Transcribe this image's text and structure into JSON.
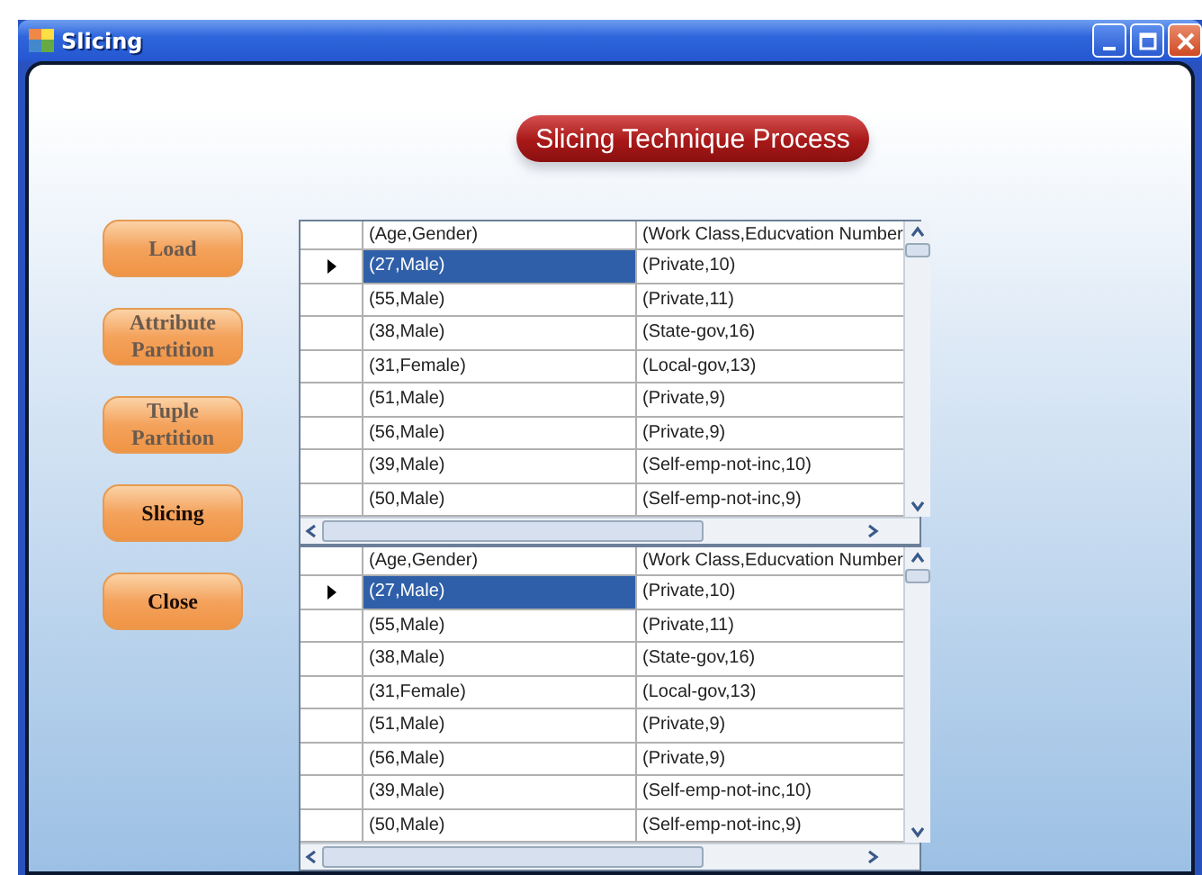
{
  "window": {
    "title": "Slicing"
  },
  "banner": "Slicing Technique Process",
  "buttons": [
    {
      "label": "Load",
      "disabled": true
    },
    {
      "label": "Attribute Partition",
      "disabled": true
    },
    {
      "label": "Tuple Partition",
      "disabled": true
    },
    {
      "label": "Slicing",
      "disabled": false
    },
    {
      "label": "Close",
      "disabled": false
    }
  ],
  "grids": [
    {
      "columns": [
        "(Age,Gender)",
        "(Work Class,Educvation Number"
      ],
      "rows": [
        {
          "cells": [
            "(27,Male)",
            "(Private,10)"
          ],
          "selected": true
        },
        {
          "cells": [
            "(55,Male)",
            "(Private,11)"
          ],
          "selected": false
        },
        {
          "cells": [
            "(38,Male)",
            "(State-gov,16)"
          ],
          "selected": false
        },
        {
          "cells": [
            "(31,Female)",
            "(Local-gov,13)"
          ],
          "selected": false
        },
        {
          "cells": [
            "(51,Male)",
            "(Private,9)"
          ],
          "selected": false
        },
        {
          "cells": [
            "(56,Male)",
            "(Private,9)"
          ],
          "selected": false
        },
        {
          "cells": [
            "(39,Male)",
            "(Self-emp-not-inc,10)"
          ],
          "selected": false
        },
        {
          "cells": [
            "(50,Male)",
            "(Self-emp-not-inc,9)"
          ],
          "selected": false
        }
      ]
    },
    {
      "columns": [
        "(Age,Gender)",
        "(Work Class,Educvation Number"
      ],
      "rows": [
        {
          "cells": [
            "(27,Male)",
            "(Private,10)"
          ],
          "selected": true
        },
        {
          "cells": [
            "(55,Male)",
            "(Private,11)"
          ],
          "selected": false
        },
        {
          "cells": [
            "(38,Male)",
            "(State-gov,16)"
          ],
          "selected": false
        },
        {
          "cells": [
            "(31,Female)",
            "(Local-gov,13)"
          ],
          "selected": false
        },
        {
          "cells": [
            "(51,Male)",
            "(Private,9)"
          ],
          "selected": false
        },
        {
          "cells": [
            "(56,Male)",
            "(Private,9)"
          ],
          "selected": false
        },
        {
          "cells": [
            "(39,Male)",
            "(Self-emp-not-inc,10)"
          ],
          "selected": false
        },
        {
          "cells": [
            "(50,Male)",
            "(Self-emp-not-inc,9)"
          ],
          "selected": false
        }
      ]
    }
  ]
}
